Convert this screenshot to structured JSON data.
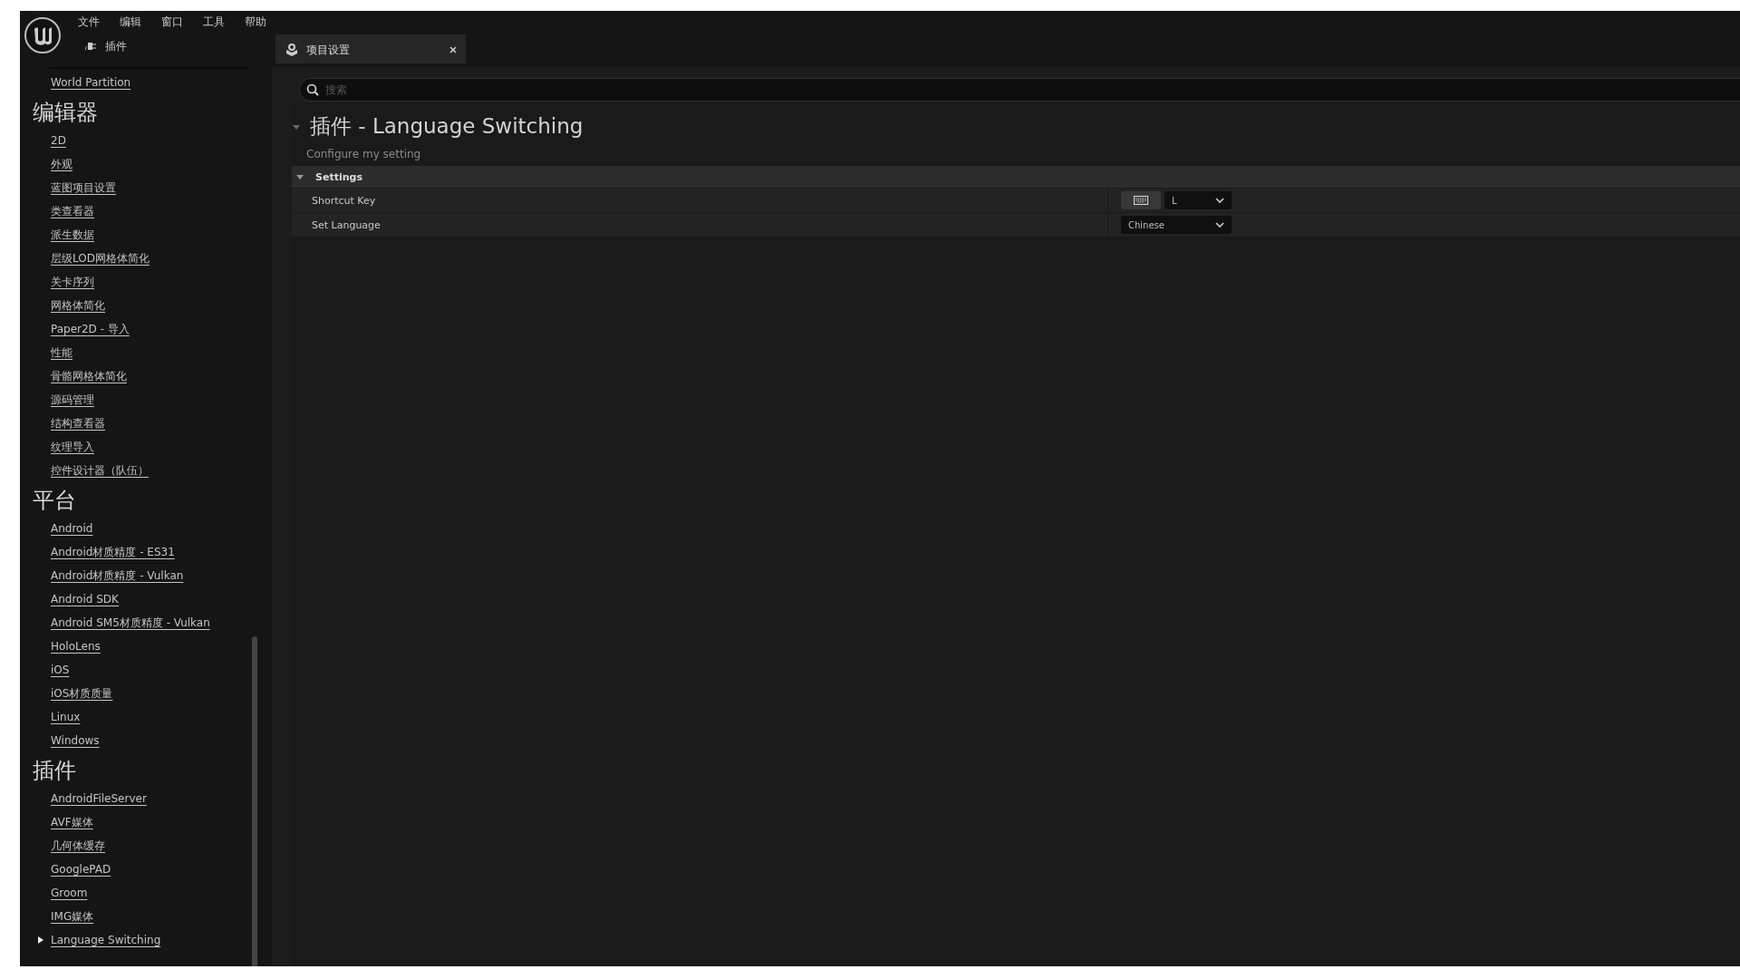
{
  "menu": [
    "文件",
    "编辑",
    "窗口",
    "工具",
    "帮助"
  ],
  "toolbar": {
    "label": "插件"
  },
  "tabs": [
    {
      "label": "项目设置",
      "selected": true
    }
  ],
  "sidebar": {
    "sections": [
      {
        "items": [
          {
            "label": "World Partition",
            "kind": "link"
          }
        ]
      },
      {
        "heading": "编辑器",
        "items": [
          {
            "label": "2D",
            "kind": "link"
          },
          {
            "label": "外观",
            "kind": "link"
          },
          {
            "label": "蓝图项目设置",
            "kind": "link"
          },
          {
            "label": "类查看器",
            "kind": "link"
          },
          {
            "label": "派生数据",
            "kind": "link"
          },
          {
            "label": "层级LOD网格体简化",
            "kind": "link"
          },
          {
            "label": "关卡序列",
            "kind": "link"
          },
          {
            "label": "网格体简化",
            "kind": "link"
          },
          {
            "label": "Paper2D - 导入",
            "kind": "link"
          },
          {
            "label": "性能",
            "kind": "link"
          },
          {
            "label": "骨骼网格体简化",
            "kind": "link"
          },
          {
            "label": "源码管理",
            "kind": "link"
          },
          {
            "label": "结构查看器",
            "kind": "link"
          },
          {
            "label": "纹理导入",
            "kind": "link"
          },
          {
            "label": "控件设计器（队伍）",
            "kind": "link"
          }
        ]
      },
      {
        "heading": "平台",
        "items": [
          {
            "label": "Android",
            "kind": "link"
          },
          {
            "label": "Android材质精度 - ES31",
            "kind": "link"
          },
          {
            "label": "Android材质精度 - Vulkan",
            "kind": "link"
          },
          {
            "label": "Android SDK",
            "kind": "link"
          },
          {
            "label": "Android SM5材质精度 - Vulkan",
            "kind": "link"
          },
          {
            "label": "HoloLens",
            "kind": "link"
          },
          {
            "label": "iOS",
            "kind": "link"
          },
          {
            "label": "iOS材质质量",
            "kind": "link"
          },
          {
            "label": "Linux",
            "kind": "link"
          },
          {
            "label": "Windows",
            "kind": "link"
          }
        ]
      },
      {
        "heading": "插件",
        "items": [
          {
            "label": "AndroidFileServer",
            "kind": "link"
          },
          {
            "label": "AVF媒体",
            "kind": "link"
          },
          {
            "label": "几何体缓存",
            "kind": "link"
          },
          {
            "label": "GooglePAD",
            "kind": "link"
          },
          {
            "label": "Groom",
            "kind": "link"
          },
          {
            "label": "IMG媒体",
            "kind": "link"
          },
          {
            "label": "Language Switching",
            "kind": "group",
            "expanded": false
          }
        ]
      }
    ]
  },
  "search": {
    "placeholder": "搜索"
  },
  "page": {
    "title": "插件 - Language Switching",
    "description": "Configure my setting",
    "expanded": true
  },
  "category": {
    "label": "Settings",
    "expanded": true,
    "properties": [
      {
        "label": "Shortcut Key",
        "kind": "key",
        "value": "L"
      },
      {
        "label": "Set Language",
        "kind": "dropdown",
        "value": "Chinese"
      }
    ]
  }
}
